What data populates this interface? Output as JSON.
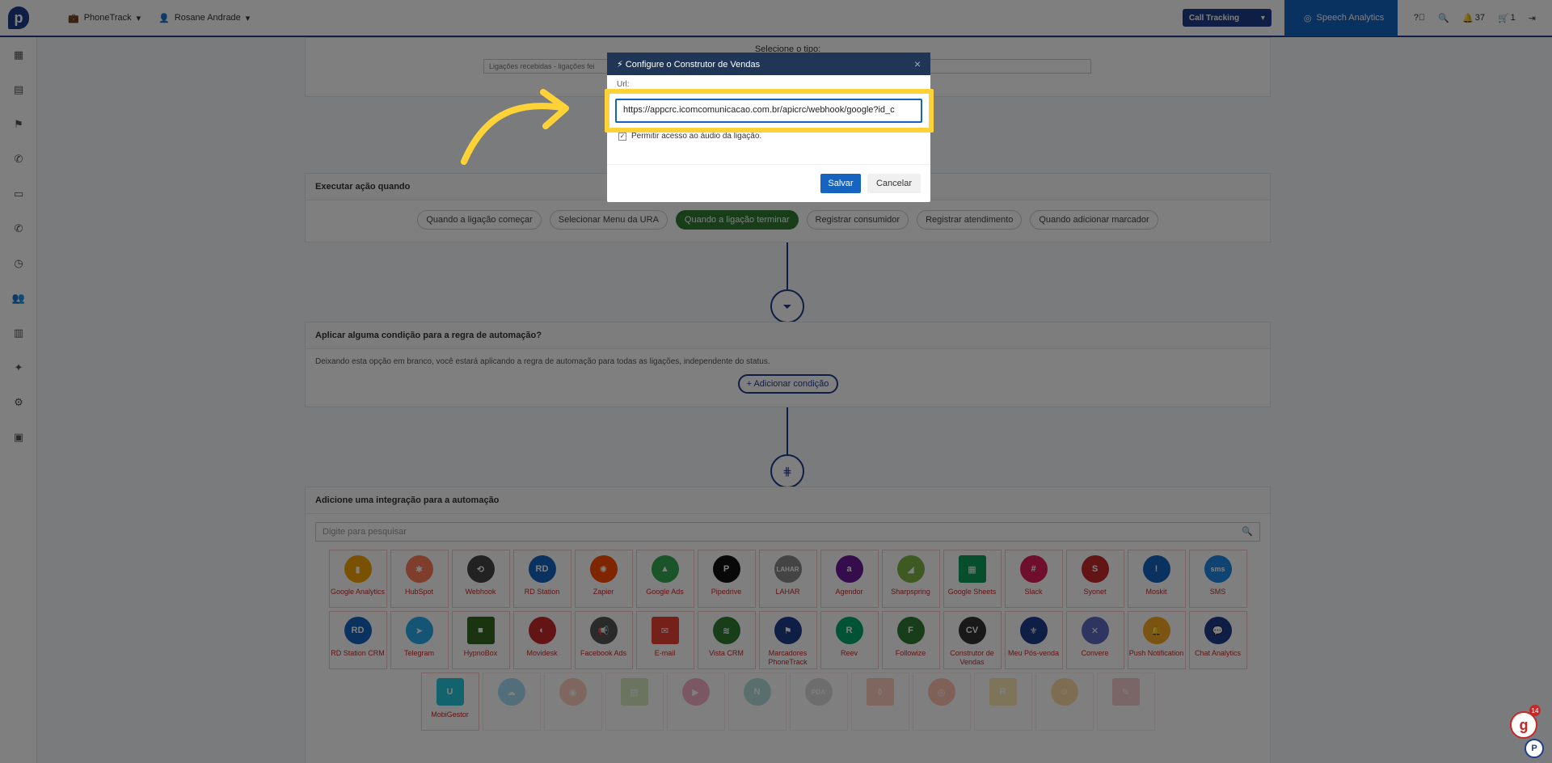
{
  "topbar": {
    "product": "PhoneTrack",
    "user": "Rosane Andrade",
    "call_tracking": "Call Tracking",
    "speech_analytics": "Speech Analytics",
    "notifications": "37",
    "cart": "1"
  },
  "type_section": {
    "label": "Selecione o tipo:",
    "select_value": "Ligações recebidas - ligações fei"
  },
  "action_section": {
    "title": "Executar ação quando",
    "pills": [
      {
        "label": "Quando a ligação começar"
      },
      {
        "label": "Selecionar Menu da URA"
      },
      {
        "label": "Quando a ligação terminar"
      },
      {
        "label": "Registrar consumidor"
      },
      {
        "label": "Registrar atendimento"
      },
      {
        "label": "Quando adicionar marcador"
      }
    ]
  },
  "condition_section": {
    "title": "Aplicar alguma condição para a regra de automação?",
    "text": "Deixando esta opção em branco, você estará aplicando a regra de automação para todas as ligações, independente do status.",
    "add_button": "Adicionar condição"
  },
  "integration_section": {
    "title": "Adicione uma integração para a automação",
    "search_placeholder": "Digite para pesquisar",
    "row1": [
      "Google Analytics",
      "HubSpot",
      "Webhook",
      "RD Station",
      "Zapier",
      "Google Ads",
      "Pipedrive",
      "LAHAR",
      "Agendor",
      "Sharpspring",
      "Google Sheets",
      "Slack",
      "Syonet",
      "Moskit",
      "SMS"
    ],
    "row2": [
      "RD Station CRM",
      "Telegram",
      "HypnoBox",
      "Movidesk",
      "Facebook Ads",
      "E-mail",
      "Vista CRM",
      "Marcadores PhoneTrack",
      "Reev",
      "Followize",
      "Construtor de Vendas",
      "Meu Pós-venda",
      "Convere",
      "Push Notification",
      "Chat Analytics"
    ],
    "row3_first": "MobiGestor",
    "logo_texts": {
      "rd": "RD",
      "pipedrive": "P",
      "lahar": "LAHAR",
      "sms": "sms",
      "cv": "CV",
      "mobigestor": "U",
      "pda": "PDA"
    }
  },
  "modal": {
    "title": "Configure o Construtor de Vendas",
    "url_label": "Url:",
    "url_value": "https://appcrc.icomcomunicacao.com.br/apicrc/webhook/google?id_c",
    "audio_label": "Permitir acesso ao áudio da ligação.",
    "save": "Salvar",
    "cancel": "Cancelar"
  },
  "corner": {
    "badge_count": "14",
    "badge_letter": "g",
    "chat_letter": "P"
  },
  "colors": {
    "brand": "#1f3d8a",
    "active_pill": "#2e7d32",
    "highlight": "#ffd338",
    "save_button": "#1565c0"
  }
}
